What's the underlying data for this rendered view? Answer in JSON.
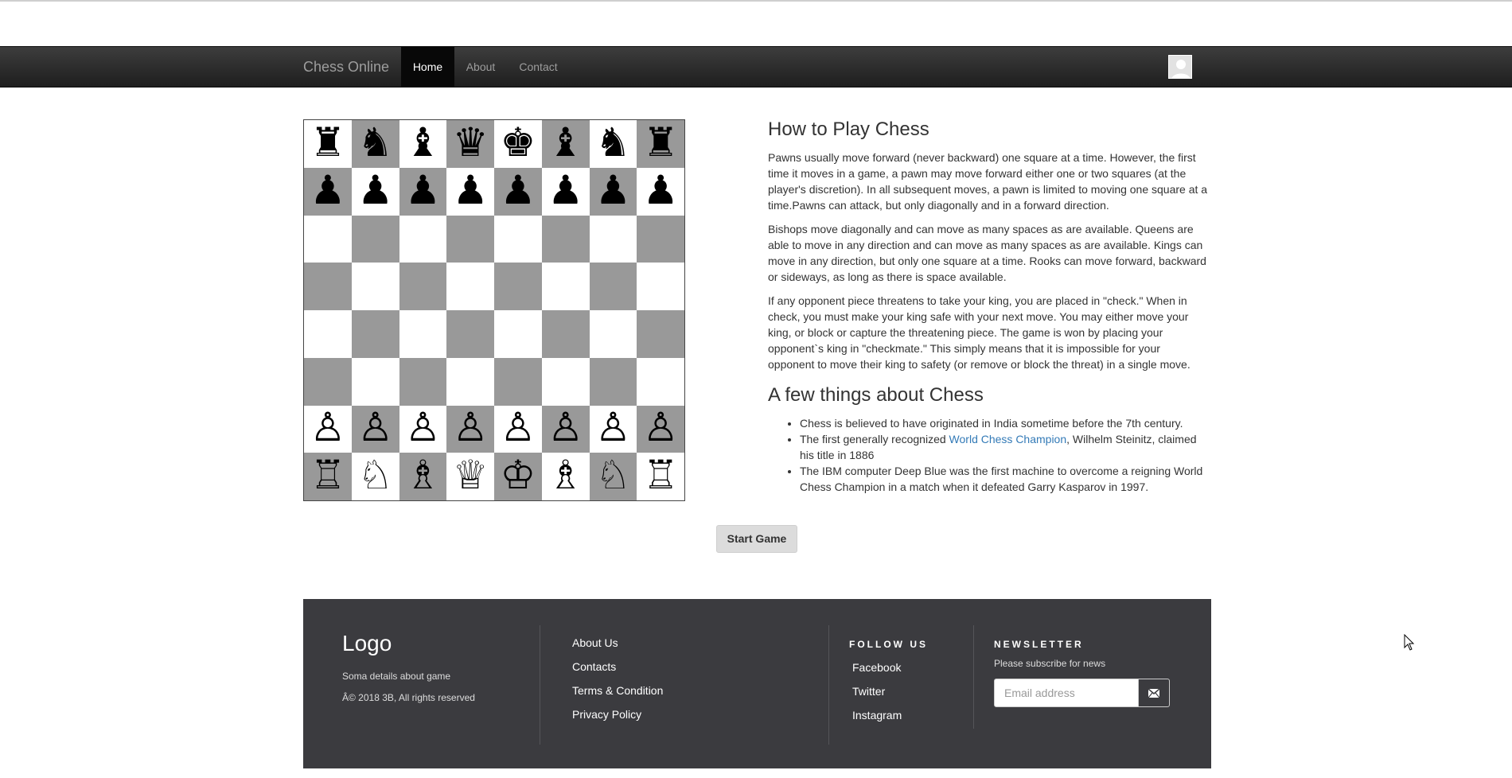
{
  "navbar": {
    "brand": "Chess Online",
    "items": [
      {
        "label": "Home",
        "active": true
      },
      {
        "label": "About",
        "active": false
      },
      {
        "label": "Contact",
        "active": false
      }
    ],
    "avatar_icon": "user-avatar-icon"
  },
  "board": {
    "ranks": [
      [
        "♜",
        "♞",
        "♝",
        "♛",
        "♚",
        "♝",
        "♞",
        "♜"
      ],
      [
        "♟",
        "♟",
        "♟",
        "♟",
        "♟",
        "♟",
        "♟",
        "♟"
      ],
      [
        "",
        "",
        "",
        "",
        "",
        "",
        "",
        ""
      ],
      [
        "",
        "",
        "",
        "",
        "",
        "",
        "",
        ""
      ],
      [
        "",
        "",
        "",
        "",
        "",
        "",
        "",
        ""
      ],
      [
        "",
        "",
        "",
        "",
        "",
        "",
        "",
        ""
      ],
      [
        "♙",
        "♙",
        "♙",
        "♙",
        "♙",
        "♙",
        "♙",
        "♙"
      ],
      [
        "♖",
        "♘",
        "♗",
        "♕",
        "♔",
        "♗",
        "♘",
        "♖"
      ]
    ],
    "light_color": "#ffffff",
    "dark_color": "#999999"
  },
  "content": {
    "heading1": "How to Play Chess",
    "paragraphs": [
      "Pawns usually move forward (never backward) one square at a time. However, the first time it moves in a game, a pawn may move forward either one or two squares (at the player's discretion). In all subsequent moves, a pawn is limited to moving one square at a time.Pawns can attack, but only diagonally and in a forward direction.",
      "Bishops move diagonally and can move as many spaces as are available. Queens are able to move in any direction and can move as many spaces as are available. Kings can move in any direction, but only one square at a time. Rooks can move forward, backward or sideways, as long as there is space available.",
      "If any opponent piece threatens to take your king, you are placed in \"check.\" When in check, you must make your king safe with your next move. You may either move your king, or block or capture the threatening piece. The game is won by placing your opponent`s king in \"checkmate.\" This simply means that it is impossible for your opponent to move their king to safety (or remove or block the threat) in a single move."
    ],
    "heading2": "A few things about Chess",
    "facts": {
      "fact1": "Chess is believed to have originated in India sometime before the 7th century.",
      "fact2_before": "The first generally recognized ",
      "fact2_link": "World Chess Champion",
      "fact2_after": ", Wilhelm Steinitz, claimed his title in 1886",
      "fact3": "The IBM computer Deep Blue was the first machine to overcome a reigning World Chess Champion in a match when it defeated Garry Kasparov in 1997."
    }
  },
  "start_button": "Start Game",
  "footer": {
    "logo": "Logo",
    "details": "Soma details about game",
    "copyright": "Â© 2018 3B, All rights reserved",
    "links": [
      "About Us",
      "Contacts",
      "Terms & Condition",
      "Privacy Policy"
    ],
    "follow_heading": "FOLLOW US",
    "social": [
      "Facebook",
      "Twitter",
      "Instagram"
    ],
    "newsletter_heading": "NEWSLETTER",
    "newsletter_text": "Please subscribe for news",
    "email_placeholder": "Email address",
    "email_icon": "envelope-icon",
    "background": "#3b3b3f"
  }
}
